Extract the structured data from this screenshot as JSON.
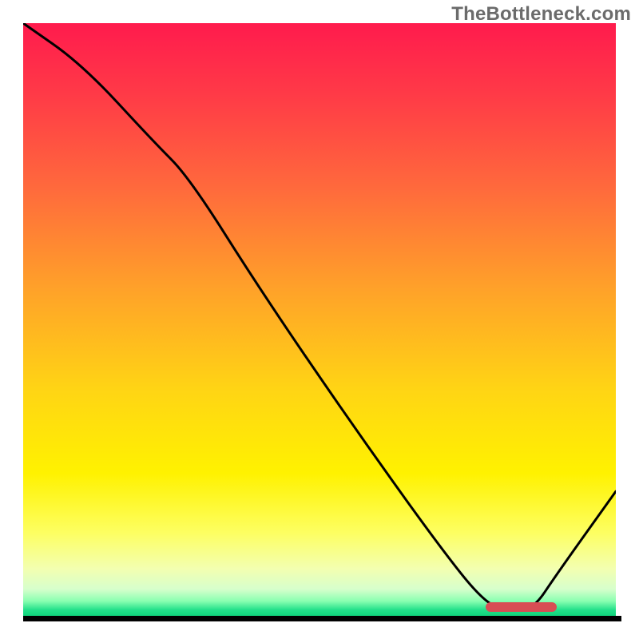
{
  "watermark": "TheBottleneck.com",
  "colors": {
    "curve": "#000000",
    "axis": "#000000",
    "marker": "#d84d54"
  },
  "gradient_stops": [
    {
      "offset": 0.0,
      "color": "#ff1b4d"
    },
    {
      "offset": 0.12,
      "color": "#ff3a47"
    },
    {
      "offset": 0.28,
      "color": "#ff6a3c"
    },
    {
      "offset": 0.45,
      "color": "#ffa229"
    },
    {
      "offset": 0.62,
      "color": "#ffd514"
    },
    {
      "offset": 0.76,
      "color": "#fff200"
    },
    {
      "offset": 0.86,
      "color": "#fdff62"
    },
    {
      "offset": 0.92,
      "color": "#f3ffb0"
    },
    {
      "offset": 0.955,
      "color": "#d7ffcc"
    },
    {
      "offset": 0.975,
      "color": "#8affb1"
    },
    {
      "offset": 0.99,
      "color": "#23e08a"
    },
    {
      "offset": 1.0,
      "color": "#0fd47c"
    }
  ],
  "chart_data": {
    "type": "line",
    "title": "",
    "xlabel": "",
    "ylabel": "",
    "xlim": [
      0,
      100
    ],
    "ylim": [
      0,
      100
    ],
    "x": [
      0,
      10,
      22,
      28,
      40,
      55,
      70,
      78,
      82,
      86,
      90,
      100
    ],
    "values": [
      100,
      93,
      80,
      74,
      55,
      33,
      12,
      2,
      1,
      1,
      7,
      21
    ],
    "optimal_range_x": [
      78,
      90
    ],
    "optimal_range_y": 1.5
  }
}
